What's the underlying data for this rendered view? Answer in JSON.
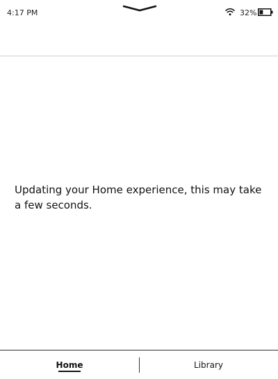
{
  "status_bar": {
    "time": "4:17 PM",
    "battery_percent": "32%",
    "battery_level": 0.32
  },
  "main": {
    "message": "Updating your Home experience, this may take a few seconds."
  },
  "bottom_nav": {
    "tabs": [
      {
        "label": "Home",
        "active": true
      },
      {
        "label": "Library",
        "active": false
      }
    ]
  },
  "icons": {
    "pull_down": "chevron-down-icon",
    "wifi": "wifi-icon",
    "battery": "battery-icon"
  }
}
